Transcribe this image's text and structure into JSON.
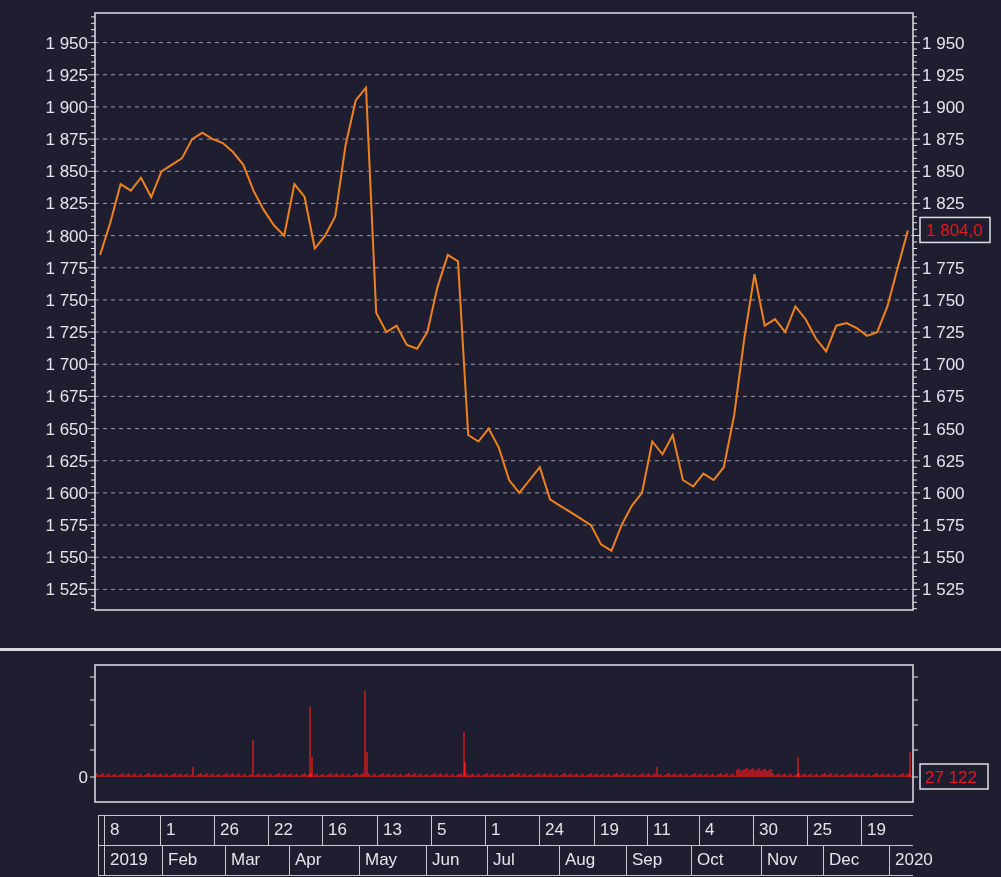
{
  "price_chart": {
    "chart_data": {
      "type": "line",
      "grid": true,
      "categories": [
        null,
        null,
        null,
        null,
        null,
        null,
        null,
        null,
        null,
        null,
        null,
        null,
        null,
        null,
        null,
        null,
        null,
        null,
        null,
        null,
        null,
        null,
        null,
        null,
        null,
        null,
        null,
        null,
        null,
        null,
        null,
        null,
        null,
        null,
        null,
        null,
        null,
        null,
        null,
        null,
        null,
        null,
        null,
        null,
        null,
        null,
        null,
        null,
        null,
        null,
        null,
        null,
        null,
        null,
        null,
        null,
        null,
        null,
        null,
        null,
        null,
        null,
        null,
        null,
        null,
        null,
        null,
        null,
        null,
        null,
        null,
        null,
        null,
        null,
        null,
        null,
        null,
        null,
        null,
        null
      ],
      "series": [
        {
          "color": "#f0821e",
          "values": [
            1785,
            1810,
            1840,
            1835,
            1845,
            1830,
            1850,
            1855,
            1860,
            1875,
            1880,
            1875,
            1872,
            1865,
            1855,
            1835,
            1820,
            1808,
            1800,
            1840,
            1830,
            1790,
            1800,
            1815,
            1870,
            1905,
            1915,
            1740,
            1725,
            1730,
            1715,
            1712,
            1725,
            1760,
            1785,
            1780,
            1645,
            1640,
            1650,
            1635,
            1610,
            1600,
            1610,
            1620,
            1595,
            1590,
            1585,
            1580,
            1575,
            1560,
            1555,
            1575,
            1590,
            1600,
            1640,
            1630,
            1645,
            1610,
            1605,
            1615,
            1610,
            1620,
            1660,
            1720,
            1770,
            1730,
            1735,
            1725,
            1745,
            1735,
            1720,
            1710,
            1730,
            1732,
            1728,
            1722,
            1725,
            1745,
            1775,
            1804
          ]
        }
      ],
      "ylim": [
        1509,
        1973
      ],
      "yticks": [
        {
          "value": 1950,
          "label": "1 950"
        },
        {
          "value": 1925,
          "label": "1 925"
        },
        {
          "value": 1900,
          "label": "1 900"
        },
        {
          "value": 1875,
          "label": "1 875"
        },
        {
          "value": 1850,
          "label": "1 850"
        },
        {
          "value": 1825,
          "label": "1 825"
        },
        {
          "value": 1800,
          "label": "1 800"
        },
        {
          "value": 1775,
          "label": "1 775"
        },
        {
          "value": 1750,
          "label": "1 750"
        },
        {
          "value": 1725,
          "label": "1 725"
        },
        {
          "value": 1700,
          "label": "1 700"
        },
        {
          "value": 1675,
          "label": "1 675"
        },
        {
          "value": 1650,
          "label": "1 650"
        },
        {
          "value": 1625,
          "label": "1 625"
        },
        {
          "value": 1600,
          "label": "1 600"
        },
        {
          "value": 1575,
          "label": "1 575"
        },
        {
          "value": 1550,
          "label": "1 550"
        },
        {
          "value": 1525,
          "label": "1 525"
        }
      ]
    },
    "last_value": "1 804,0"
  },
  "volume": {
    "zero_label": "0",
    "last_value": "27 122"
  },
  "timeline": {
    "days": [
      "8",
      "1",
      "26",
      "22",
      "16",
      "13",
      "5",
      "1",
      "24",
      "19",
      "11",
      "4",
      "30",
      "25",
      "19"
    ],
    "months": [
      "2019",
      "Feb",
      "Mar",
      "Apr",
      "May",
      "Jun",
      "Jul",
      "Aug",
      "Sep",
      "Oct",
      "Nov",
      "Dec",
      "2020"
    ]
  }
}
